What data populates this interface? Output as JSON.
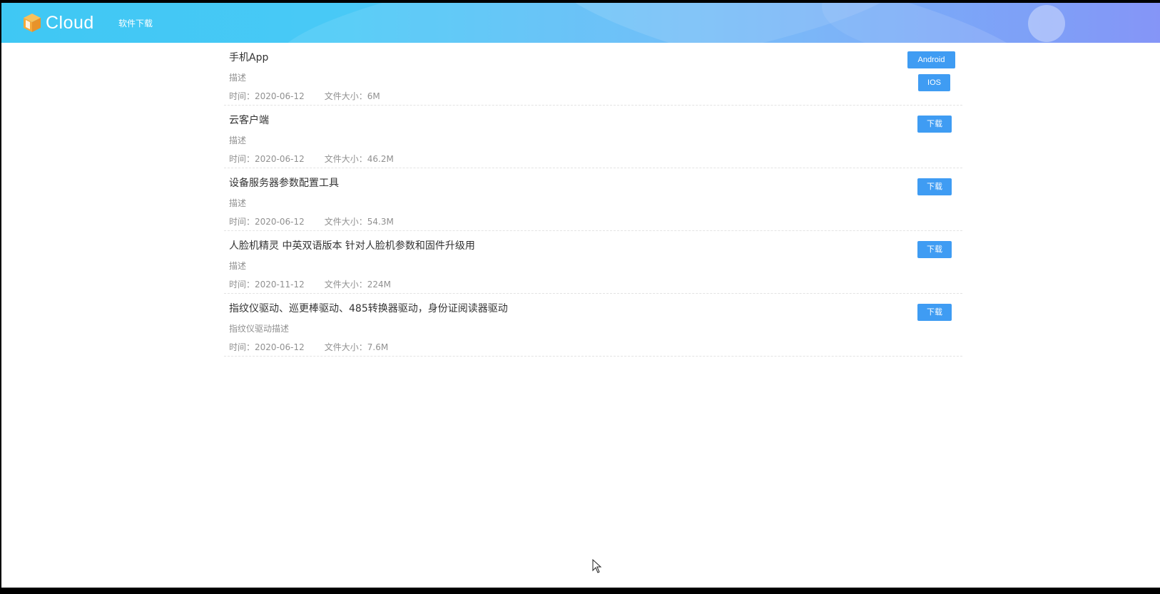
{
  "header": {
    "logo_text": "Cloud",
    "nav_link": "软件下载",
    "colors": {
      "gradient_start": "#3fc8f4",
      "gradient_end": "#7b8df7",
      "logo_orange": "#f4a93a"
    }
  },
  "items": [
    {
      "title": "手机App",
      "desc": "描述",
      "time": "时间：2020-06-12",
      "size": "文件大小：6M",
      "buttons": [
        "Android",
        "IOS"
      ]
    },
    {
      "title": "云客户端",
      "desc": "描述",
      "time": "时间：2020-06-12",
      "size": "文件大小：46.2M",
      "buttons": [
        "下载"
      ]
    },
    {
      "title": "设备服务器参数配置工具",
      "desc": "描述",
      "time": "时间：2020-06-12",
      "size": "文件大小：54.3M",
      "buttons": [
        "下载"
      ]
    },
    {
      "title": "人脸机精灵 中英双语版本 针对人脸机参数和固件升级用",
      "desc": "描述",
      "time": "时间：2020-11-12",
      "size": "文件大小：224M",
      "buttons": [
        "下载"
      ]
    },
    {
      "title": "指纹仪驱动、巡更棒驱动、485转换器驱动，身份证阅读器驱动",
      "desc": "指纹仪驱动描述",
      "time": "时间：2020-06-12",
      "size": "文件大小：7.6M",
      "buttons": [
        "下载"
      ]
    }
  ],
  "button_color": "#3f9cf3",
  "icons": {
    "logo": "cube-logo-icon",
    "cursor": "mouse-pointer-icon"
  }
}
